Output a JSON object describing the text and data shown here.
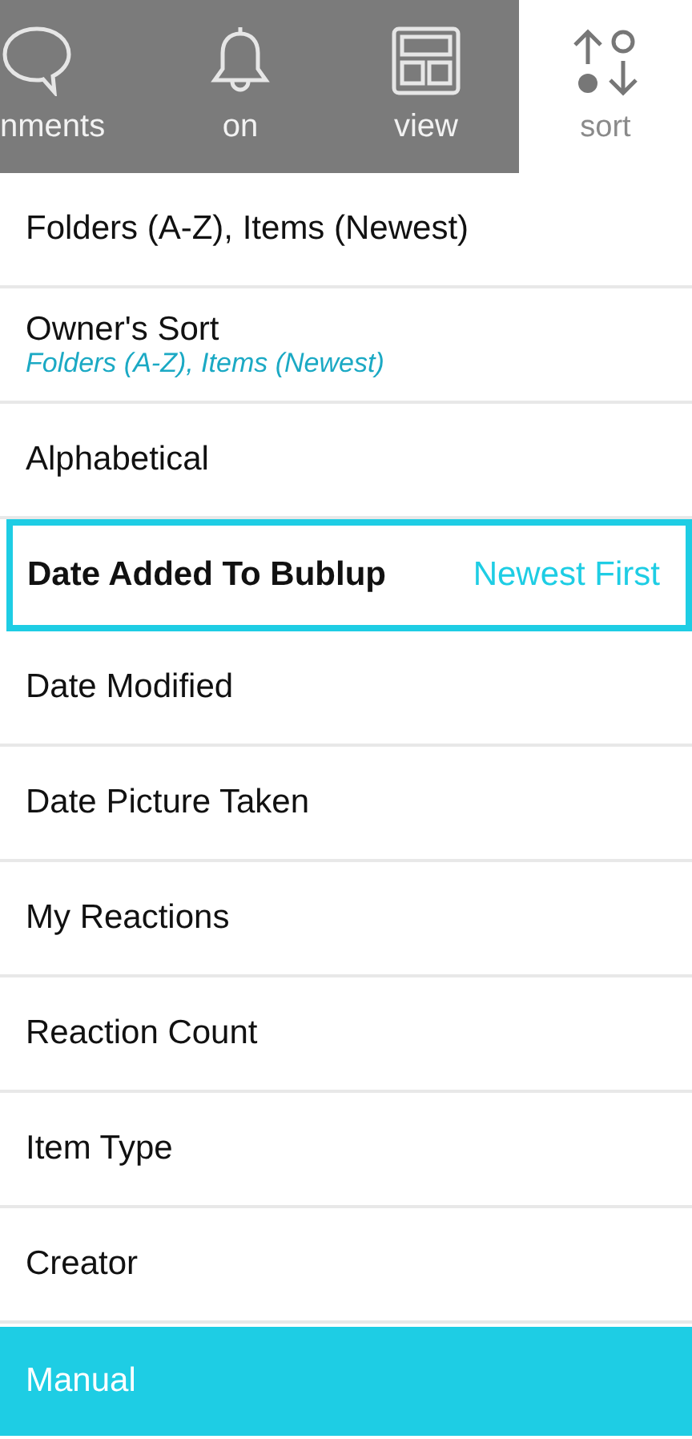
{
  "toolbar": [
    {
      "label": "nments",
      "kind": "comment",
      "selected": false
    },
    {
      "label": "on",
      "kind": "bell",
      "selected": false
    },
    {
      "label": "view",
      "kind": "layout",
      "selected": false
    },
    {
      "label": "sort",
      "kind": "sort",
      "selected": true
    }
  ],
  "sort_options": [
    {
      "label": "Folders (A-Z), Items (Newest)",
      "selected": false
    },
    {
      "label": "Owner's Sort",
      "subtitle": "Folders (A-Z), Items (Newest)",
      "selected": false
    },
    {
      "label": "Alphabetical",
      "selected": false
    },
    {
      "label": "Date Added To Bublup",
      "detail": "Newest First",
      "selected": true
    },
    {
      "label": "Date Modified",
      "selected": false
    },
    {
      "label": "Date Picture Taken",
      "selected": false
    },
    {
      "label": "My Reactions",
      "selected": false
    },
    {
      "label": "Reaction Count",
      "selected": false
    },
    {
      "label": "Item Type",
      "selected": false
    },
    {
      "label": "Creator",
      "selected": false
    }
  ],
  "manual_button": {
    "label": "Manual"
  }
}
